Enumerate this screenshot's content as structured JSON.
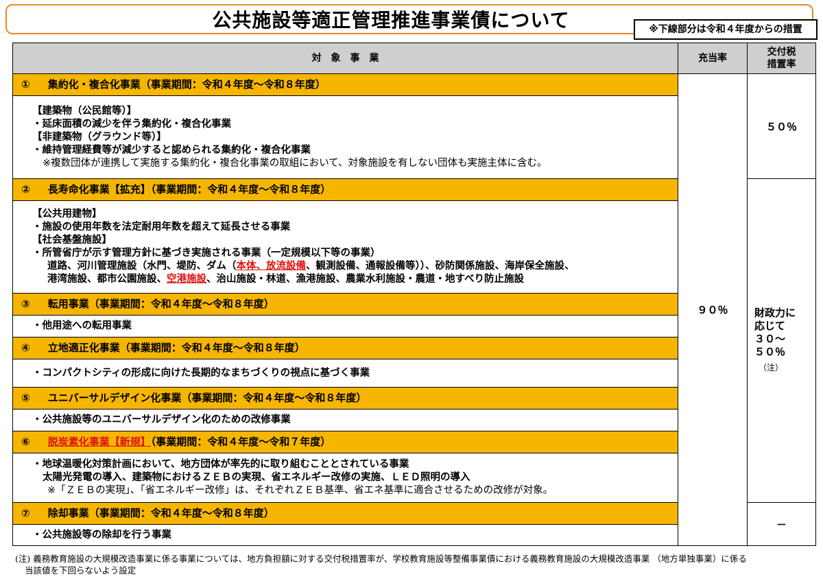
{
  "title": "公共施設等適正管理推進事業債について",
  "note": "※下線部分は令和４年度からの措置",
  "header": {
    "col_project": "対　象　事　業",
    "col_rate": "充当率",
    "col_tax_1": "交付税",
    "col_tax_2": "措置率"
  },
  "sections": [
    {
      "num": "①",
      "title": "集約化・複合化事業（事業期間：令和４年度～令和８年度）",
      "lines": [
        "【建築物（公民館等）】",
        "・延床面積の減少を伴う集約化・複合化事業",
        "【非建築物（グラウンド等）】",
        "・維持管理経費等が減少すると認められる集約化・複合化事業",
        "※複数団体が連携して実施する集約化・複合化事業の取組において、対象施設を有しない団体も実施主体に含む。"
      ]
    },
    {
      "num": "②",
      "title": "長寿命化事業【拡充】（事業期間：令和４年度～令和８年度）",
      "lines": [
        "【公共用建物】",
        "・施設の使用年数を法定耐用年数を超えて延長させる事業",
        "【社会基盤施設】",
        "・所管省庁が示す管理方針に基づき実施される事業（一定規模以下等の事業）"
      ],
      "line5_a": "道路、河川管理施設（水門、堤防、ダム（",
      "line5_red": "本体、放流設備",
      "line5_b": "、観測設備、通報設備等））、砂防関係施設、海岸保全施設、",
      "line6_a": "港湾施設、都市公園施設、",
      "line6_red": "空港施設",
      "line6_b": "、治山施設・林道、漁港施設、農業水利施設・農道・地すべり防止施設"
    },
    {
      "num": "③",
      "title": "転用事業（事業期間：令和４年度～令和８年度）",
      "lines": [
        "・他用途への転用事業"
      ]
    },
    {
      "num": "④",
      "title": "立地適正化事業（事業期間：令和４年度～令和８年度）",
      "lines": [
        "・コンパクトシティの形成に向けた長期的なまちづくりの視点に基づく事業"
      ]
    },
    {
      "num": "⑤",
      "title": "ユニバーサルデザイン化事業（事業期間：令和４年度～令和８年度）",
      "lines": [
        "・公共施設等のユニバーサルデザイン化のための改修事業"
      ]
    },
    {
      "num": "⑥",
      "title_red": "脱炭素化事業【新規】",
      "title": "（事業期間：令和４年度～令和７年度）",
      "lines": [
        "・地球温暖化対策計画において、地方団体が率先的に取り組むこととされている事業",
        "太陽光発電の導入、建築物におけるＺＥＢの実現、省エネルギー改修の実施、ＬＥＤ照明の導入",
        "※「ＺＥＢの実現」、「省エネルギー改修」は、それぞれＺＥＢ基準、省エネ基準に適合させるための改修が対象。"
      ]
    },
    {
      "num": "⑦",
      "title": "除却事業（事業期間：令和４年度～令和８年度）",
      "lines": [
        "・公共施設等の除却を行う事業"
      ]
    }
  ],
  "rates": {
    "charge": "９０％",
    "tax_a": "５０％",
    "tax_b_1": "財政力に",
    "tax_b_2": "応じて",
    "tax_b_3": "３０～",
    "tax_b_4": "５０％",
    "tax_b_note": "（注）",
    "tax_c": "－"
  },
  "footnote_1": "(注) 義務教育施設の大規模改造事業に係る事業については、地方負担額に対する交付税措置率が、学校教育施設等整備事業債における義務教育施設の大規模改造事業 （地方単独事業）に係る",
  "footnote_2": "当該値を下回らないよう設定"
}
